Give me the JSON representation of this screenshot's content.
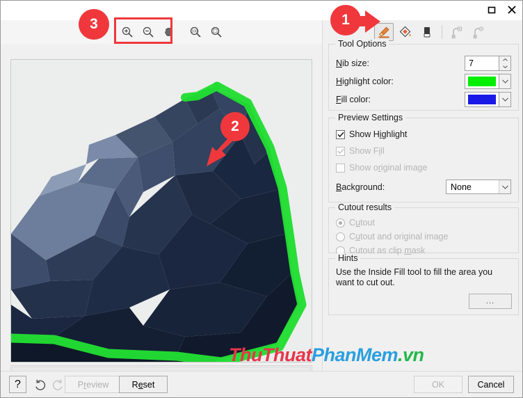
{
  "window": {
    "maximize_icon": "maximize-icon",
    "close_icon": "close-icon"
  },
  "zoom_toolbar": {
    "buttons": [
      {
        "name": "zoom-in-icon",
        "tooltip": "Zoom In"
      },
      {
        "name": "zoom-out-icon",
        "tooltip": "Zoom Out"
      },
      {
        "name": "pan-hand-icon",
        "tooltip": "Pan"
      },
      {
        "name": "zoom-100-icon",
        "tooltip": "Zoom 100%",
        "label": "100"
      },
      {
        "name": "zoom-fit-icon",
        "tooltip": "Fit to Window"
      }
    ]
  },
  "tool_strip": {
    "tools": [
      {
        "name": "highlighter-tool-icon",
        "label": "Highlight Edge",
        "selected": true,
        "enabled": true
      },
      {
        "name": "inside-fill-tool-icon",
        "label": "Inside Fill",
        "selected": false,
        "enabled": true
      },
      {
        "name": "eraser-tool-icon",
        "label": "Eraser",
        "selected": false,
        "enabled": true
      },
      {
        "name": "add-node-tool-icon",
        "label": "Add Node",
        "selected": false,
        "enabled": false
      },
      {
        "name": "remove-node-tool-icon",
        "label": "Remove Node",
        "selected": false,
        "enabled": false
      }
    ]
  },
  "tool_options": {
    "title": "Tool Options",
    "nib_size": {
      "label_pre": "N",
      "label_post": "ib size:",
      "value": "7"
    },
    "highlight_color": {
      "label_pre": "H",
      "label_post": "ighlight color:",
      "value": "#00ee00"
    },
    "fill_color": {
      "label_pre": "F",
      "label_post": "ill color:",
      "value": "#1a1ae6"
    }
  },
  "preview_settings": {
    "title": "Preview Settings",
    "items": [
      {
        "label_a": "Show H",
        "label_u": "i",
        "label_b": "ghlight",
        "checked": true,
        "enabled": true
      },
      {
        "label_a": "Show F",
        "label_u": "i",
        "label_b": "ll",
        "checked": true,
        "enabled": false
      },
      {
        "label_a": "Show o",
        "label_u": "r",
        "label_b": "iginal image",
        "checked": false,
        "enabled": false
      }
    ],
    "background": {
      "label_pre": "B",
      "label_post": "ackground:",
      "value": "None"
    }
  },
  "cutout_results": {
    "title": "Cutout results",
    "options": [
      {
        "label_a": "C",
        "label_u": "u",
        "label_b": "tout",
        "selected": true
      },
      {
        "label_a": "C",
        "label_u": "u",
        "label_b": "tout and original image",
        "selected": false
      },
      {
        "label_a": "Cutout as clip ",
        "label_u": "m",
        "label_b": "ask",
        "selected": false
      }
    ]
  },
  "hints": {
    "title": "Hints",
    "text": "Use the Inside Fill tool to fill the area you want to cut out.",
    "more_button": "..."
  },
  "bottom_bar": {
    "help_label": "?",
    "undo_icon": "undo-icon",
    "redo_icon": "redo-icon",
    "preview": {
      "label_a": "P",
      "label_u": "r",
      "label_b": "eview",
      "enabled": false
    },
    "reset": {
      "label_a": "R",
      "label_u": "e",
      "label_b": "set",
      "enabled": true
    },
    "ok": {
      "label": "OK",
      "enabled": false
    },
    "cancel": {
      "label": "Cancel",
      "enabled": true
    }
  },
  "annotations": {
    "badge_1": "1",
    "badge_2": "2",
    "badge_3": "3",
    "accent_color": "#f0383c"
  },
  "watermark": {
    "part1": "ThuThuat",
    "part2": "PhanMem",
    "part3": ".vn",
    "color1": "#e8354a",
    "color2": "#2a9ee0",
    "color3": "#25b84a"
  },
  "canvas": {
    "subject": "low-poly wolf head illustration",
    "highlight_color": "#22dd33"
  }
}
